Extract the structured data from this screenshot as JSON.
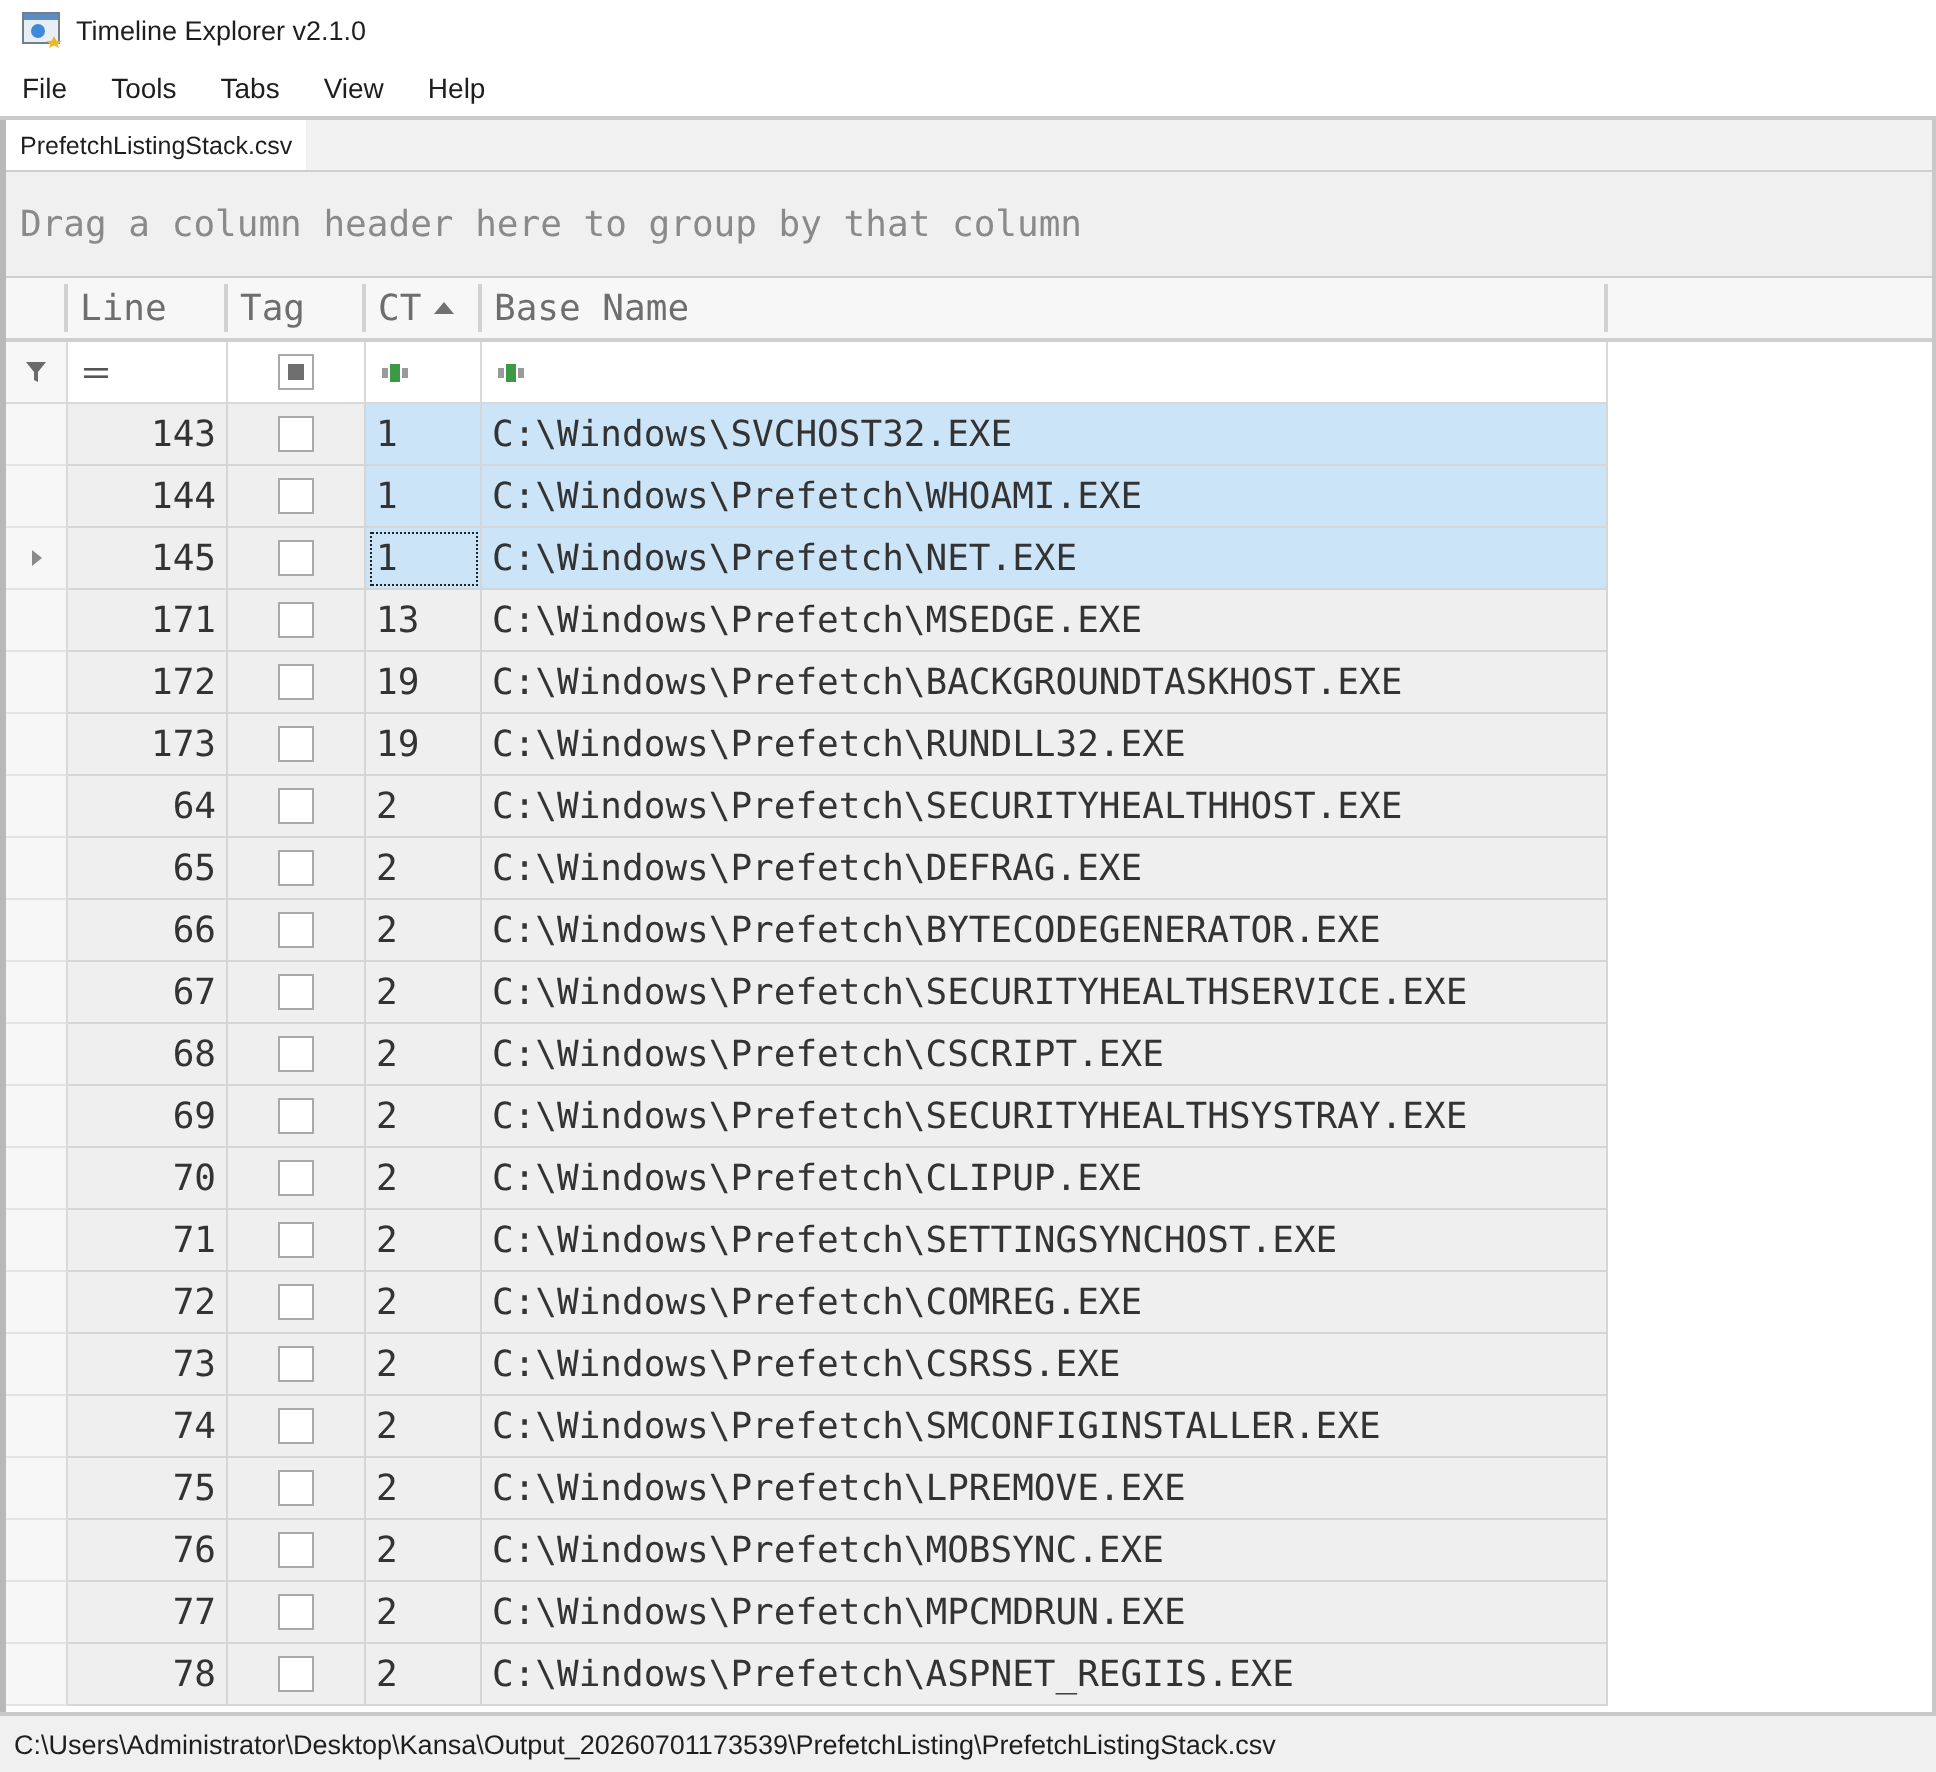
{
  "window": {
    "title": "Timeline Explorer v2.1.0"
  },
  "menu": [
    "File",
    "Tools",
    "Tabs",
    "View",
    "Help"
  ],
  "tabs": [
    {
      "label": "PrefetchListingStack.csv",
      "selected": true
    }
  ],
  "group_panel": {
    "hint": "Drag a column header here to group by that column"
  },
  "table": {
    "columns": [
      {
        "label": "Line",
        "sorted": false
      },
      {
        "label": "Tag",
        "sorted": false
      },
      {
        "label": "CT",
        "sorted": true
      },
      {
        "label": "Base Name",
        "sorted": false
      }
    ],
    "filters": [
      {
        "kind": "operator"
      },
      {
        "kind": "checkbox",
        "indeterminate": true
      },
      {
        "kind": "text"
      },
      {
        "kind": "text"
      }
    ],
    "rows": [
      {
        "line": "143",
        "tagged": false,
        "ct": "1",
        "base_name": "C:\\Windows\\SVCHOST32.EXE",
        "selected": true,
        "current": false
      },
      {
        "line": "144",
        "tagged": false,
        "ct": "1",
        "base_name": "C:\\Windows\\Prefetch\\WHOAMI.EXE",
        "selected": true,
        "current": false
      },
      {
        "line": "145",
        "tagged": false,
        "ct": "1",
        "base_name": "C:\\Windows\\Prefetch\\NET.EXE",
        "selected": true,
        "current": true
      },
      {
        "line": "171",
        "tagged": false,
        "ct": "13",
        "base_name": "C:\\Windows\\Prefetch\\MSEDGE.EXE",
        "selected": false,
        "current": false
      },
      {
        "line": "172",
        "tagged": false,
        "ct": "19",
        "base_name": "C:\\Windows\\Prefetch\\BACKGROUNDTASKHOST.EXE",
        "selected": false,
        "current": false
      },
      {
        "line": "173",
        "tagged": false,
        "ct": "19",
        "base_name": "C:\\Windows\\Prefetch\\RUNDLL32.EXE",
        "selected": false,
        "current": false
      },
      {
        "line": "64",
        "tagged": false,
        "ct": "2",
        "base_name": "C:\\Windows\\Prefetch\\SECURITYHEALTHHOST.EXE",
        "selected": false,
        "current": false
      },
      {
        "line": "65",
        "tagged": false,
        "ct": "2",
        "base_name": "C:\\Windows\\Prefetch\\DEFRAG.EXE",
        "selected": false,
        "current": false
      },
      {
        "line": "66",
        "tagged": false,
        "ct": "2",
        "base_name": "C:\\Windows\\Prefetch\\BYTECODEGENERATOR.EXE",
        "selected": false,
        "current": false
      },
      {
        "line": "67",
        "tagged": false,
        "ct": "2",
        "base_name": "C:\\Windows\\Prefetch\\SECURITYHEALTHSERVICE.EXE",
        "selected": false,
        "current": false
      },
      {
        "line": "68",
        "tagged": false,
        "ct": "2",
        "base_name": "C:\\Windows\\Prefetch\\CSCRIPT.EXE",
        "selected": false,
        "current": false
      },
      {
        "line": "69",
        "tagged": false,
        "ct": "2",
        "base_name": "C:\\Windows\\Prefetch\\SECURITYHEALTHSYSTRAY.EXE",
        "selected": false,
        "current": false
      },
      {
        "line": "70",
        "tagged": false,
        "ct": "2",
        "base_name": "C:\\Windows\\Prefetch\\CLIPUP.EXE",
        "selected": false,
        "current": false
      },
      {
        "line": "71",
        "tagged": false,
        "ct": "2",
        "base_name": "C:\\Windows\\Prefetch\\SETTINGSYNCHOST.EXE",
        "selected": false,
        "current": false
      },
      {
        "line": "72",
        "tagged": false,
        "ct": "2",
        "base_name": "C:\\Windows\\Prefetch\\COMREG.EXE",
        "selected": false,
        "current": false
      },
      {
        "line": "73",
        "tagged": false,
        "ct": "2",
        "base_name": "C:\\Windows\\Prefetch\\CSRSS.EXE",
        "selected": false,
        "current": false
      },
      {
        "line": "74",
        "tagged": false,
        "ct": "2",
        "base_name": "C:\\Windows\\Prefetch\\SMCONFIGINSTALLER.EXE",
        "selected": false,
        "current": false
      },
      {
        "line": "75",
        "tagged": false,
        "ct": "2",
        "base_name": "C:\\Windows\\Prefetch\\LPREMOVE.EXE",
        "selected": false,
        "current": false
      },
      {
        "line": "76",
        "tagged": false,
        "ct": "2",
        "base_name": "C:\\Windows\\Prefetch\\MOBSYNC.EXE",
        "selected": false,
        "current": false
      },
      {
        "line": "77",
        "tagged": false,
        "ct": "2",
        "base_name": "C:\\Windows\\Prefetch\\MPCMDRUN.EXE",
        "selected": false,
        "current": false
      },
      {
        "line": "78",
        "tagged": false,
        "ct": "2",
        "base_name": "C:\\Windows\\Prefetch\\ASPNET_REGIIS.EXE",
        "selected": false,
        "current": false
      }
    ]
  },
  "status_bar": {
    "path": "C:\\Users\\Administrator\\Desktop\\Kansa\\Output_20260701173539\\PrefetchListing\\PrefetchListingStack.csv"
  }
}
